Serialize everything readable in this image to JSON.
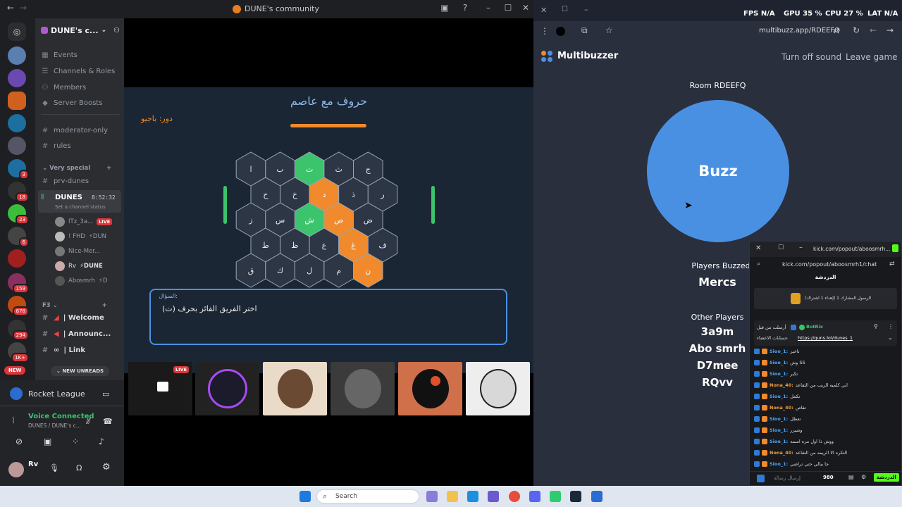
{
  "discord": {
    "window_title": "DUNE's community",
    "server_name": "DUNE's c...",
    "menu": [
      "Events",
      "Channels & Roles",
      "Members",
      "Server Boosts"
    ],
    "channels_top": [
      "moderator-only",
      "rules"
    ],
    "category1": "Very special",
    "prv_channel": "prv-dunes",
    "voice_channel": {
      "name": "DUNES",
      "time": "8:52:32",
      "status": "Set a channel status"
    },
    "voice_users": [
      {
        "name": "ITz_3a...",
        "tag": "LIVE"
      },
      {
        "name": "! FHD",
        "tag": "⚡DUN"
      },
      {
        "name": "Nice-Mer...",
        "tag": ""
      },
      {
        "name": "Rv",
        "tag": "⚡DUNE"
      },
      {
        "name": "Abosmrh",
        "tag": "⚡D"
      }
    ],
    "category2": "F3",
    "f3_channels": [
      "| Welcome",
      "| Announc...",
      "| Link"
    ],
    "new_unreads": "NEW UNREADS",
    "new_badge": "NEW",
    "server_badges": [
      "3",
      "18",
      "23",
      "6",
      "159",
      "878",
      "294",
      "1K+"
    ],
    "activity": "Rocket League",
    "voice_connected": "Voice Connected",
    "voice_location": "DUNES / DUNE's c...",
    "user": "Rv",
    "live_tile": "LIVE"
  },
  "game": {
    "title": "حروف مع عاصم",
    "turn": "دور: باجيو",
    "hex_rows": [
      [
        {
          "l": "ا",
          "c": "d"
        },
        {
          "l": "ب",
          "c": "d"
        },
        {
          "l": "ت",
          "c": "g"
        },
        {
          "l": "ث",
          "c": "d"
        },
        {
          "l": "ج",
          "c": "d"
        }
      ],
      [
        {
          "l": "ح",
          "c": "d"
        },
        {
          "l": "خ",
          "c": "d"
        },
        {
          "l": "د",
          "c": "o"
        },
        {
          "l": "ذ",
          "c": "d"
        },
        {
          "l": "ر",
          "c": "d"
        }
      ],
      [
        {
          "l": "ز",
          "c": "d"
        },
        {
          "l": "س",
          "c": "d"
        },
        {
          "l": "ش",
          "c": "g"
        },
        {
          "l": "ص",
          "c": "o"
        },
        {
          "l": "ض",
          "c": "d"
        }
      ],
      [
        {
          "l": "ط",
          "c": "d"
        },
        {
          "l": "ظ",
          "c": "d"
        },
        {
          "l": "ع",
          "c": "d"
        },
        {
          "l": "غ",
          "c": "o"
        },
        {
          "l": "ف",
          "c": "d"
        }
      ],
      [
        {
          "l": "ق",
          "c": "d"
        },
        {
          "l": "ك",
          "c": "d"
        },
        {
          "l": "ل",
          "c": "d"
        },
        {
          "l": "م",
          "c": "d"
        },
        {
          "l": "ن",
          "c": "o"
        }
      ]
    ],
    "colors": {
      "d": "#2d3645",
      "g": "#3bc46b",
      "o": "#f08a2c"
    },
    "question_label": "السؤال:",
    "question_text": "اختر الفريق الفائز بحرف (ت)"
  },
  "multibuzzer": {
    "brand": "Multibuzzer",
    "url": "multibuzz.app/RDEEFQ",
    "turn_off_sound": "Turn off sound",
    "leave_game": "Leave game",
    "room": "Room RDEEFQ",
    "buzz": "Buzz",
    "players_buzzed_label": "Players Buzzed",
    "players_buzzed": [
      "Mercs"
    ],
    "other_players_label": "Other Players",
    "other_players": [
      "3a9m",
      "Abo smrh",
      "D7mee",
      "RQvv"
    ]
  },
  "stats": {
    "fps_label": "FPS",
    "fps": "N/A",
    "gpu_label": "GPU",
    "gpu": "35 %",
    "cpu_label": "CPU",
    "cpu": "27 %",
    "lat_label": "LAT",
    "lat": "N/A"
  },
  "kick": {
    "url": "kick.com/popout/aboosmrh1/chat",
    "title_url": "kick.com/popout/aboosmrh...",
    "header": "الدردشة",
    "pinned": "(إهداء 1 اشتراك) الرسول المشارك 1",
    "bot_name": "BotRix",
    "bot_prefix": "أرسلت من قبل",
    "bot_text": "حسابات الاعضاء",
    "bot_link": "https://guns.lol/dunes_1",
    "messages": [
      {
        "u": "Sioo_1:",
        "t": "تاخير"
      },
      {
        "u": "Sioo_1:",
        "t": "وش SS"
      },
      {
        "u": "Sioo_1:",
        "t": "تكير"
      },
      {
        "u": "Nona_40:",
        "t": "ابي كلميه الريب من التقاعد"
      },
      {
        "u": "Sioo_1:",
        "t": "تكمل"
      },
      {
        "u": "Nona_40:",
        "t": "تقاص"
      },
      {
        "u": "Sioo_1:",
        "t": "تعطل"
      },
      {
        "u": "Sioo_1:",
        "t": "وشيرر"
      },
      {
        "u": "Sioo_1:",
        "t": "ووش ذا اول مره اسمه"
      },
      {
        "u": "Nona_40:",
        "t": "التكره الا الريمه من التقاعد"
      },
      {
        "u": "Sioo_1:",
        "t": "جا يبالي حتي تراضي"
      }
    ],
    "input_placeholder": "إرسال رسالة",
    "points": "980",
    "chat_button": "الدردشة"
  },
  "taskbar": {
    "search": "Search"
  }
}
